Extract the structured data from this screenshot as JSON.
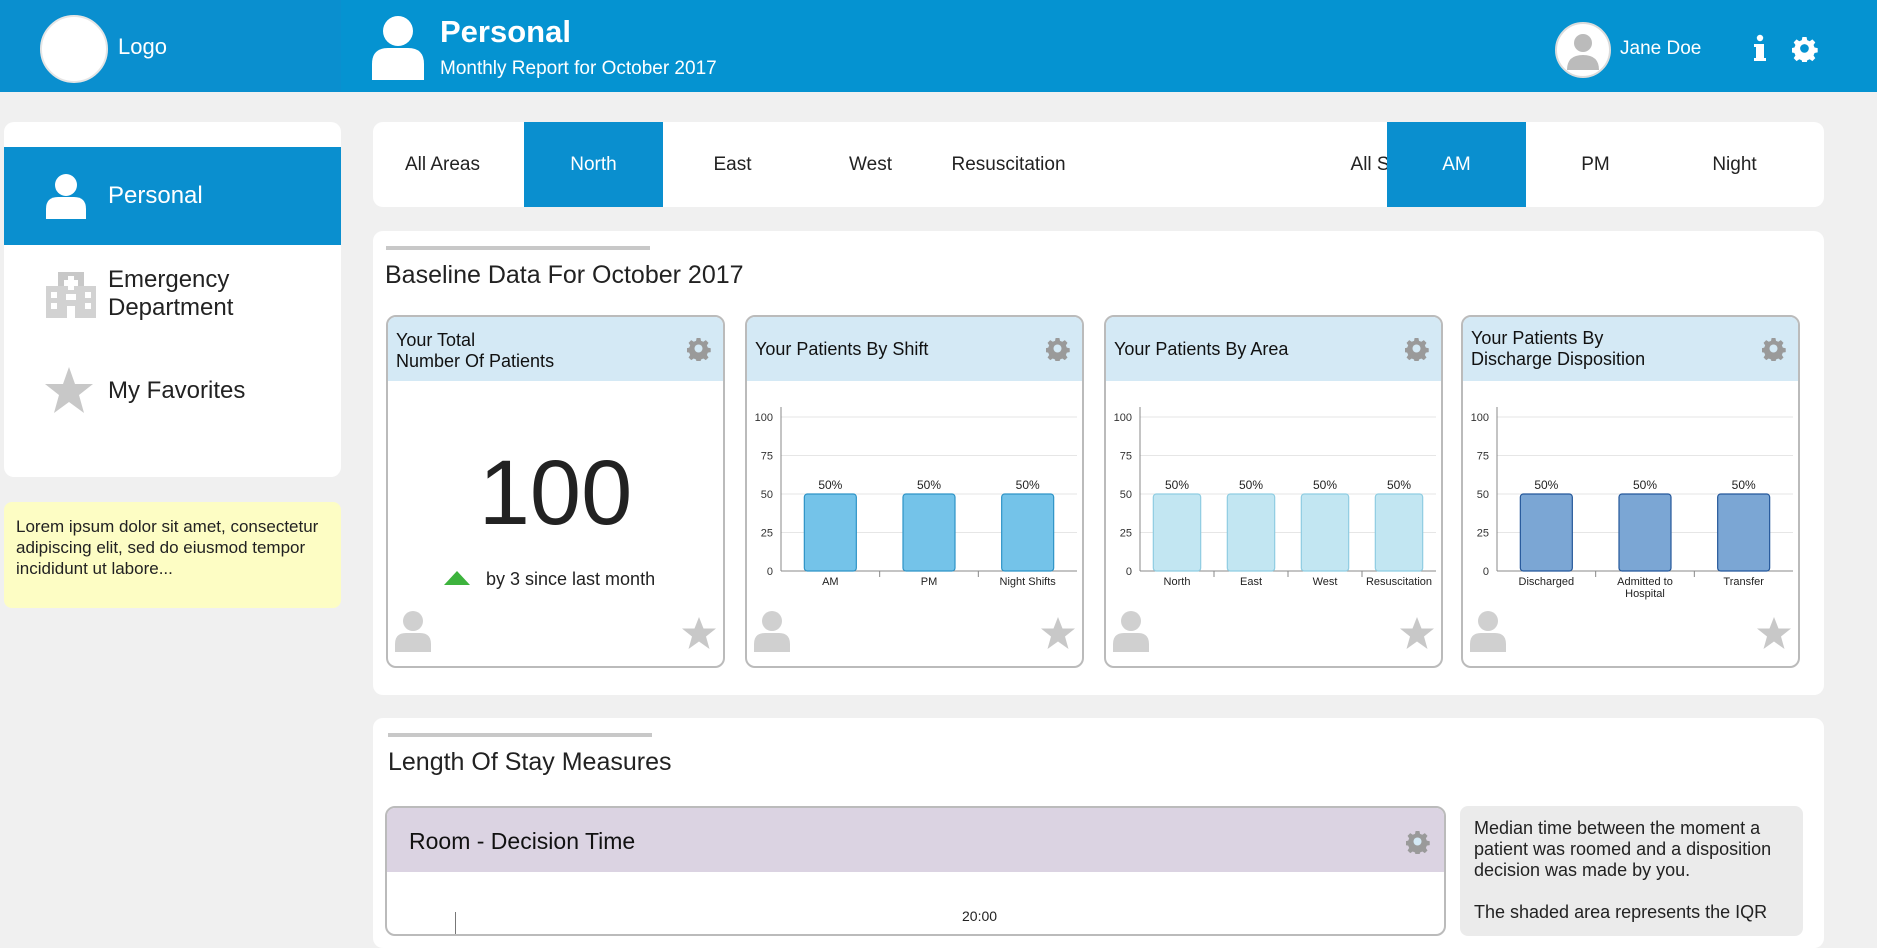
{
  "header": {
    "logo_label": "Logo",
    "title": "Personal",
    "subtitle": "Monthly Report for October 2017",
    "user_name": "Jane Doe",
    "brand_color": "#0593d1"
  },
  "sidebar": {
    "items": [
      {
        "label": "Personal",
        "icon": "person-icon",
        "active": true
      },
      {
        "label_line1": "Emergency",
        "label_line2": "Department",
        "icon": "hospital-icon",
        "active": false
      },
      {
        "label": "My Favorites",
        "icon": "star-icon",
        "active": false
      }
    ],
    "note": "Lorem ipsum dolor sit amet, consectetur adipiscing elit, sed do eiusmod tempor incididunt ut labore..."
  },
  "filters": {
    "areas": [
      "All Areas",
      "North",
      "East",
      "West",
      "Resuscitation"
    ],
    "active_area": "North",
    "shifts": [
      "All Shifts",
      "AM",
      "PM",
      "Night"
    ],
    "active_shift": "AM"
  },
  "baseline": {
    "title": "Baseline Data For October 2017",
    "total_card": {
      "title_line1": "Your Total",
      "title_line2": "Number Of Patients",
      "value": "100",
      "delta_text": "by 3 since last month",
      "delta_direction": "up"
    }
  },
  "chart_data": [
    {
      "type": "bar",
      "title": "Your Patients By Shift",
      "categories": [
        "AM",
        "PM",
        "Night Shifts"
      ],
      "values": [
        50,
        50,
        50
      ],
      "data_labels": [
        "50%",
        "50%",
        "50%"
      ],
      "yticks": [
        "0",
        "25",
        "50",
        "75",
        "100"
      ],
      "ylim": [
        0,
        100
      ],
      "bar_color": "#74c3e9",
      "bar_stroke": "#2d93c6"
    },
    {
      "type": "bar",
      "title": "Your Patients By Area",
      "categories": [
        "North",
        "East",
        "West",
        "Resuscitation"
      ],
      "values": [
        50,
        50,
        50,
        50
      ],
      "data_labels": [
        "50%",
        "50%",
        "50%",
        "50%"
      ],
      "yticks": [
        "0",
        "25",
        "50",
        "75",
        "100"
      ],
      "ylim": [
        0,
        100
      ],
      "bar_color": "#c2e6f2",
      "bar_stroke": "#8fcde2"
    },
    {
      "type": "bar",
      "title_line1": "Your Patients By",
      "title_line2": "Discharge Disposition",
      "categories": [
        "Discharged",
        "Admitted to Hospital",
        "Transfer"
      ],
      "category_lines": [
        [
          "Discharged"
        ],
        [
          "Admitted to",
          "Hospital"
        ],
        [
          "Transfer"
        ]
      ],
      "values": [
        50,
        50,
        50
      ],
      "data_labels": [
        "50%",
        "50%",
        "50%"
      ],
      "yticks": [
        "0",
        "25",
        "50",
        "75",
        "100"
      ],
      "ylim": [
        0,
        100
      ],
      "bar_color": "#7ba6d4",
      "bar_stroke": "#24579a"
    }
  ],
  "los": {
    "title": "Length Of Stay Measures",
    "card_title": "Room - Decision Time",
    "tick_label": "20:00",
    "note_p1": "Median time between the moment a patient was roomed and a disposition decision was made by you.",
    "note_p2": "The shaded area represents the IQR"
  }
}
